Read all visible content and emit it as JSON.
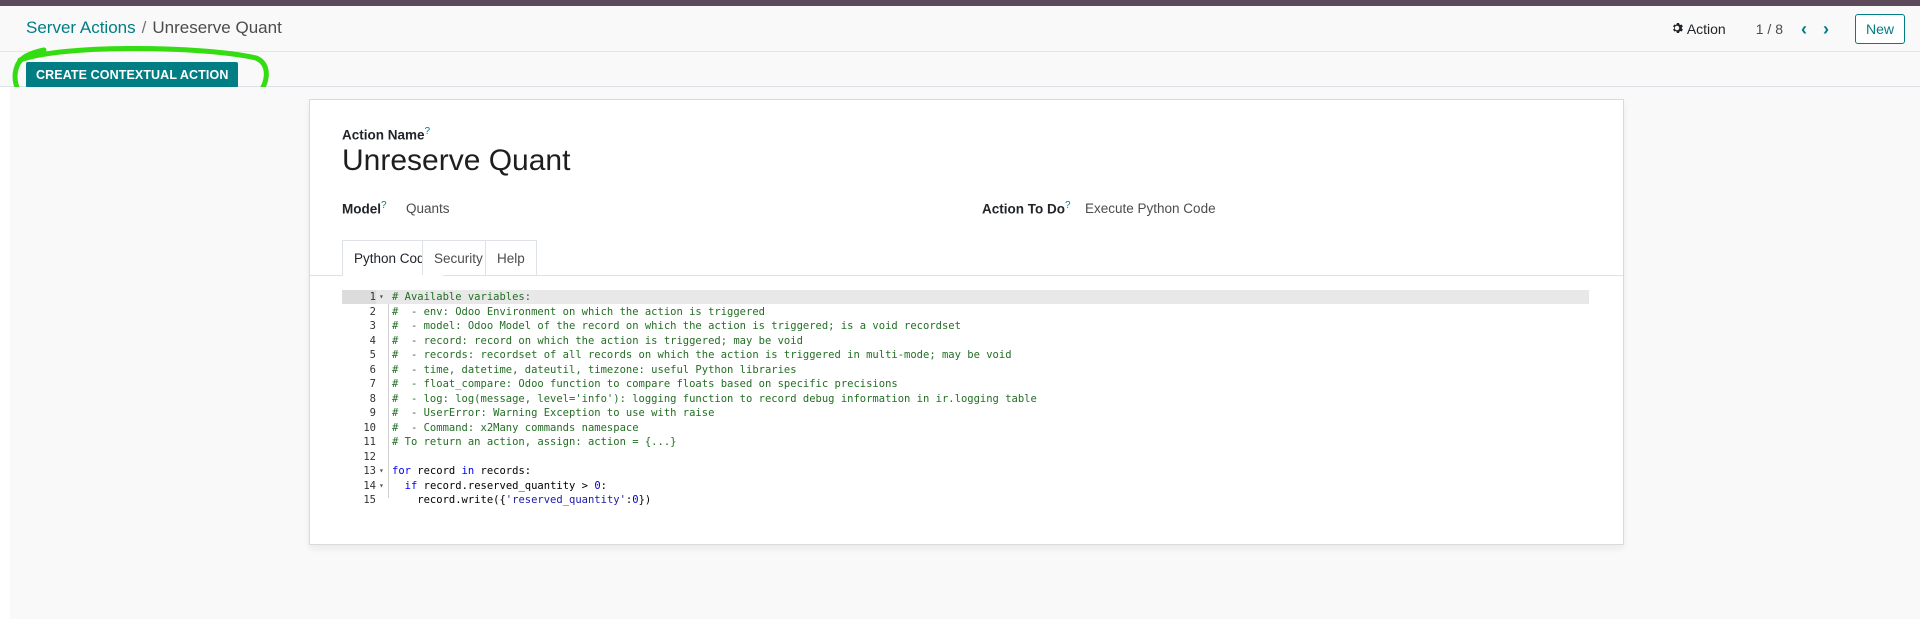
{
  "header": {
    "breadcrumb_parent": "Server Actions",
    "breadcrumb_separator": "/",
    "breadcrumb_current": "Unreserve Quant",
    "action_menu_label": "Action",
    "pager_text": "1 / 8",
    "new_button_label": "New"
  },
  "toolbar": {
    "create_contextual_action_label": "CREATE CONTEXTUAL ACTION"
  },
  "form": {
    "action_name_label": "Action Name",
    "action_name_value": "Unreserve Quant",
    "model_label": "Model",
    "model_value": "Quants",
    "action_to_do_label": "Action To Do",
    "action_to_do_value": "Execute Python Code",
    "help_marker": "?"
  },
  "tabs": [
    {
      "label": "Python Code",
      "active": true
    },
    {
      "label": "Security",
      "active": false
    },
    {
      "label": "Help",
      "active": false
    }
  ],
  "code_lines": [
    "# Available variables:",
    "#  - env: Odoo Environment on which the action is triggered",
    "#  - model: Odoo Model of the record on which the action is triggered; is a void recordset",
    "#  - record: record on which the action is triggered; may be void",
    "#  - records: recordset of all records on which the action is triggered in multi-mode; may be void",
    "#  - time, datetime, dateutil, timezone: useful Python libraries",
    "#  - float_compare: Odoo function to compare floats based on specific precisions",
    "#  - log: log(message, level='info'): logging function to record debug information in ir.logging table",
    "#  - UserError: Warning Exception to use with raise",
    "#  - Command: x2Many commands namespace",
    "# To return an action, assign: action = {...}",
    "",
    "for record in records:",
    "  if record.reserved_quantity > 0:",
    "    record.write({'reserved_quantity':0})"
  ],
  "colors": {
    "accent": "#017e84",
    "top_bar": "#5d4a5c",
    "highlight_annotation": "#33dd11",
    "comment": "#236e24"
  },
  "icons": {
    "action_menu": "gear-icon",
    "pager_prev": "chevron-left-icon",
    "pager_next": "chevron-right-icon",
    "fold_marker": "caret-down-icon"
  }
}
